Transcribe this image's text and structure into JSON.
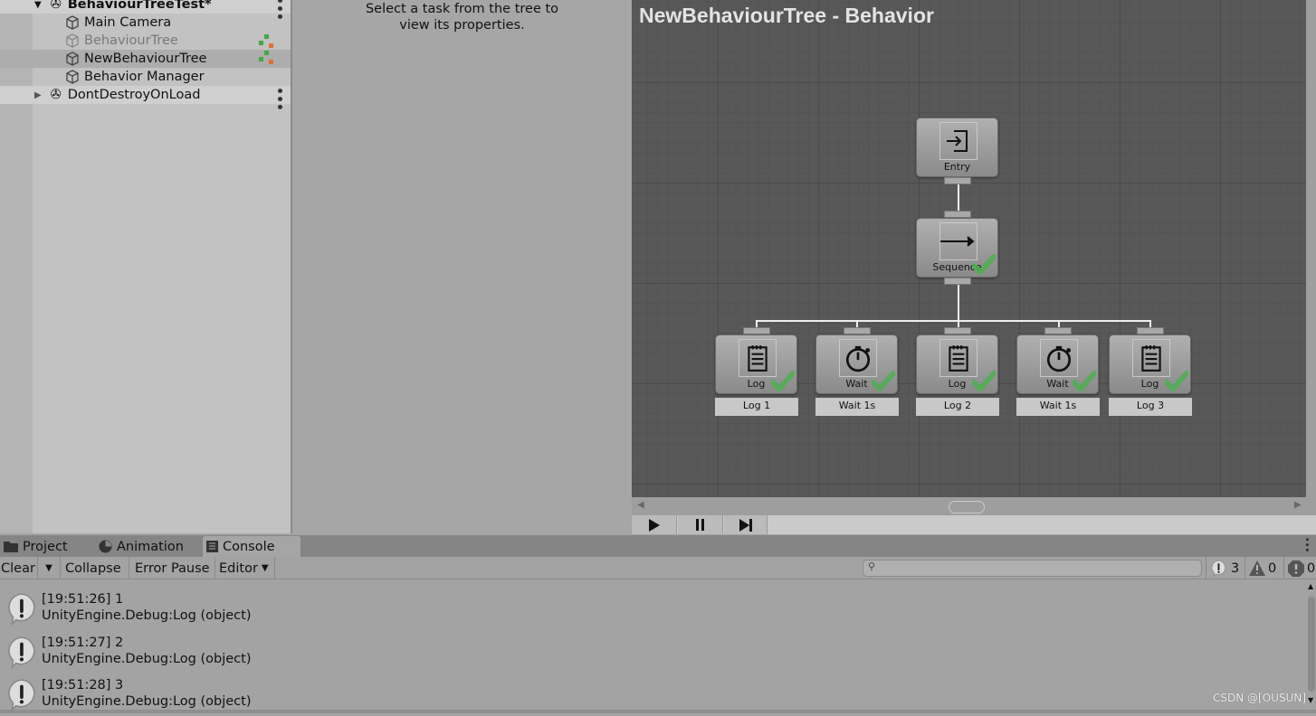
{
  "hierarchy": {
    "scene": "BehaviourTreeTest*",
    "items": [
      {
        "label": "Main Camera"
      },
      {
        "label": "BehaviourTree",
        "disabled": true
      },
      {
        "label": "NewBehaviourTree",
        "selected": true
      },
      {
        "label": "Behavior Manager"
      }
    ],
    "dont_destroy": "DontDestroyOnLoad"
  },
  "inspector": {
    "message_line1": "Select a task from the tree to",
    "message_line2": "view its properties."
  },
  "graph": {
    "title": "NewBehaviourTree - Behavior",
    "entry": {
      "label": "Entry",
      "icon": "entry-icon"
    },
    "sequence": {
      "label": "Sequence",
      "icon": "sequence-arrow-icon",
      "status": "success"
    },
    "children": [
      {
        "type": "Log",
        "name": "Log 1",
        "icon": "log-icon",
        "status": "success"
      },
      {
        "type": "Wait",
        "name": "Wait 1s",
        "icon": "stopwatch-icon",
        "status": "success"
      },
      {
        "type": "Log",
        "name": "Log 2",
        "icon": "log-icon",
        "status": "success"
      },
      {
        "type": "Wait",
        "name": "Wait 1s",
        "icon": "stopwatch-icon",
        "status": "success"
      },
      {
        "type": "Log",
        "name": "Log 3",
        "icon": "log-icon",
        "status": "success"
      }
    ]
  },
  "tabs": [
    {
      "label": "Project",
      "icon": "folder-icon"
    },
    {
      "label": "Animation",
      "icon": "animation-icon"
    },
    {
      "label": "Console",
      "icon": "console-icon",
      "active": true
    }
  ],
  "console": {
    "clear": "Clear",
    "collapse": "Collapse",
    "error_pause": "Error Pause",
    "editor": "Editor",
    "search_placeholder": "",
    "counts": {
      "info": "3",
      "warning": "0",
      "error": "0"
    },
    "logs": [
      {
        "line1": "[19:51:26] 1",
        "line2": "UnityEngine.Debug:Log (object)"
      },
      {
        "line1": "[19:51:27] 2",
        "line2": "UnityEngine.Debug:Log (object)"
      },
      {
        "line1": "[19:51:28] 3",
        "line2": "UnityEngine.Debug:Log (object)"
      }
    ]
  },
  "watermark": "CSDN @[OUSUN]",
  "colors": {
    "success": "#4caf50",
    "graph_bg": "#585858"
  }
}
